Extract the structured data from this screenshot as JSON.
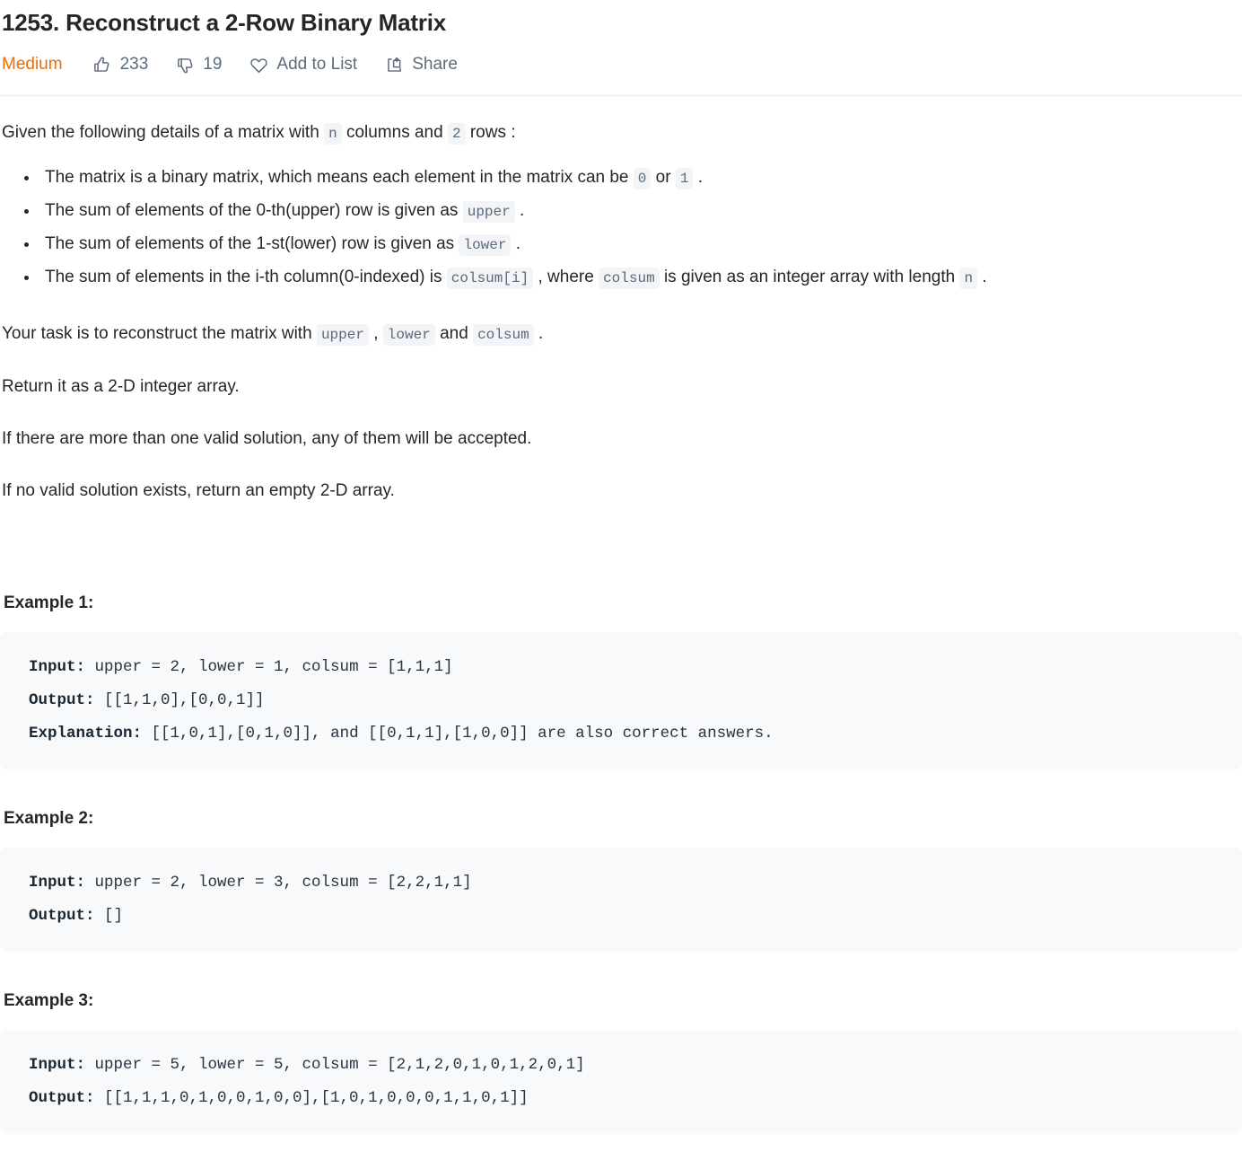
{
  "header": {
    "title": "1253. Reconstruct a 2-Row Binary Matrix",
    "difficulty": "Medium",
    "difficulty_color": "#ef6c00",
    "likes": "233",
    "dislikes": "19",
    "add_to_list": "Add to List",
    "share": "Share",
    "icons": {
      "like": "thumbs-up-icon",
      "dislike": "thumbs-down-icon",
      "favorite": "heart-icon",
      "share": "share-icon"
    }
  },
  "description": {
    "intro": {
      "p1": "Given the following details of a matrix with",
      "code_n": "n",
      "p2": "columns and",
      "code_2": "2",
      "p3": "rows :"
    },
    "bullets": [
      {
        "t1": "The matrix is a binary matrix, which means each element in the matrix can be",
        "c1": "0",
        "t2": "or",
        "c2": "1",
        "t3": "."
      },
      {
        "t1": "The sum of elements of the 0-th(upper) row is given as",
        "c1": "upper",
        "t2": ".",
        "c2": "",
        "t3": ""
      },
      {
        "t1": "The sum of elements of the 1-st(lower) row is given as",
        "c1": "lower",
        "t2": ".",
        "c2": "",
        "t3": ""
      },
      {
        "t1": "The sum of elements in the i-th column(0-indexed) is",
        "c1": "colsum[i]",
        "t2": ", where",
        "c2": "colsum",
        "t3": "is given as an integer array with length",
        "c3": "n",
        "t4": "."
      }
    ],
    "task": {
      "p1": "Your task is to reconstruct the matrix with",
      "c1": "upper",
      "p2": ",",
      "c2": "lower",
      "p3": "and",
      "c3": "colsum",
      "p4": "."
    },
    "return_line": "Return it as a 2-D integer array.",
    "multiple_line": "If there are more than one valid solution, any of them will be accepted.",
    "empty_line": "If no valid solution exists, return an empty 2-D array."
  },
  "examples": [
    {
      "heading": "Example 1:",
      "input_label": "Input:",
      "input_value": " upper = 2, lower = 1, colsum = [1,1,1]",
      "output_label": "Output:",
      "output_value": " [[1,1,0],[0,0,1]]",
      "explanation_label": "Explanation:",
      "explanation_value": " [[1,0,1],[0,1,0]], and [[0,1,1],[1,0,0]] are also correct answers."
    },
    {
      "heading": "Example 2:",
      "input_label": "Input:",
      "input_value": " upper = 2, lower = 3, colsum = [2,2,1,1]",
      "output_label": "Output:",
      "output_value": " []",
      "explanation_label": "",
      "explanation_value": ""
    },
    {
      "heading": "Example 3:",
      "input_label": "Input:",
      "input_value": " upper = 5, lower = 5, colsum = [2,1,2,0,1,0,1,2,0,1]",
      "output_label": "Output:",
      "output_value": " [[1,1,1,0,1,0,0,1,0,0],[1,0,1,0,0,0,1,1,0,1]]",
      "explanation_label": "",
      "explanation_value": ""
    }
  ]
}
